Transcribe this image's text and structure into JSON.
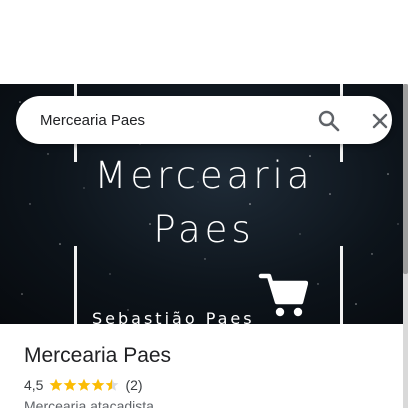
{
  "search": {
    "value": "Mercearia Paes",
    "search_icon": "search-icon",
    "close_icon": "close-icon"
  },
  "hero": {
    "title_line1": "Mercearia",
    "title_line2": "Paes",
    "subtitle": "Sebastião Paes",
    "cart_icon": "shopping-cart-icon"
  },
  "place": {
    "name": "Mercearia Paes",
    "rating": "4,5",
    "rating_value": 4.5,
    "rating_max": 5,
    "reviews": "(2)",
    "category": "Mercearia atacadista"
  },
  "colors": {
    "star": "#fbbc04",
    "star_empty": "#dadce0",
    "hero_bg": "#0d141b"
  }
}
